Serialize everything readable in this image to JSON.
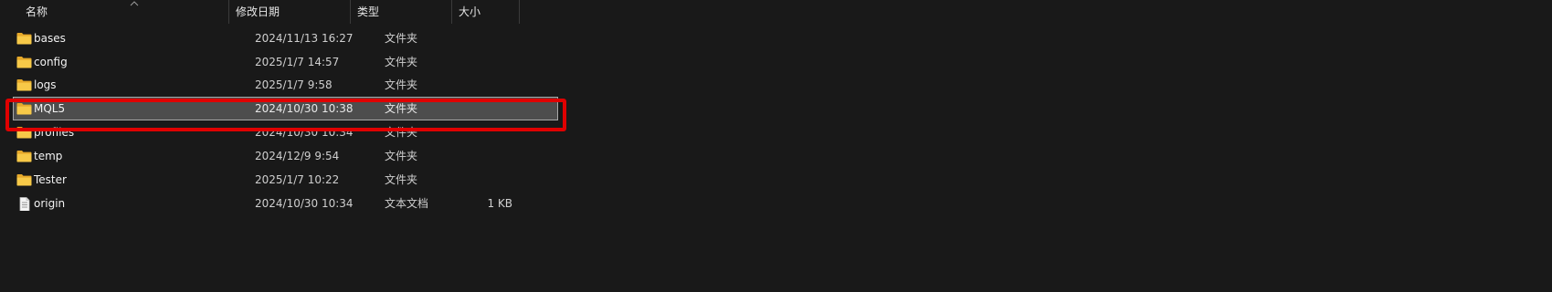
{
  "columns": {
    "name": "名称",
    "date_modified": "修改日期",
    "type": "类型",
    "size": "大小"
  },
  "rows": [
    {
      "name": "bases",
      "date": "2024/11/13 16:27",
      "type": "文件夹",
      "size": "",
      "icon": "folder-icon"
    },
    {
      "name": "config",
      "date": "2025/1/7 14:57",
      "type": "文件夹",
      "size": "",
      "icon": "folder-icon"
    },
    {
      "name": "logs",
      "date": "2025/1/7 9:58",
      "type": "文件夹",
      "size": "",
      "icon": "folder-icon"
    },
    {
      "name": "MQL5",
      "date": "2024/10/30 10:38",
      "type": "文件夹",
      "size": "",
      "icon": "folder-icon",
      "selected": true
    },
    {
      "name": "profiles",
      "date": "2024/10/30 10:34",
      "type": "文件夹",
      "size": "",
      "icon": "folder-icon"
    },
    {
      "name": "temp",
      "date": "2024/12/9 9:54",
      "type": "文件夹",
      "size": "",
      "icon": "folder-icon"
    },
    {
      "name": "Tester",
      "date": "2025/1/7 10:22",
      "type": "文件夹",
      "size": "",
      "icon": "folder-icon"
    },
    {
      "name": "origin",
      "date": "2024/10/30 10:34",
      "type": "文本文档",
      "size": "1 KB",
      "icon": "text-file-icon"
    }
  ],
  "colors": {
    "background": "#191919",
    "selection": "#4d4d4d",
    "highlight": "#e00000",
    "folder": "#f5c445"
  }
}
